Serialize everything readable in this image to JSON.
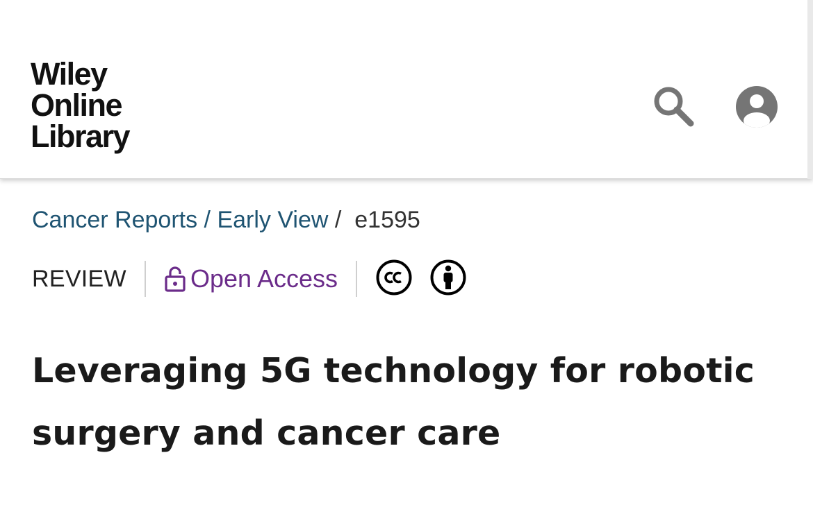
{
  "header": {
    "logo_lines": [
      "Wiley",
      "Online",
      "Library"
    ],
    "search_icon": "search-icon",
    "account_icon": "account-circle-icon"
  },
  "breadcrumb": {
    "journal": "Cancer Reports",
    "issue": "Early View",
    "article_id": "e1595"
  },
  "meta": {
    "article_type": "REVIEW",
    "access_label": "Open Access",
    "access_icon": "unlock-icon",
    "license_icons": [
      "creative-commons-icon",
      "attribution-icon"
    ],
    "access_color": "#6b2c8a",
    "link_color": "#1f5472"
  },
  "article": {
    "title": "Leveraging 5G technology for robotic surgery and cancer care"
  }
}
